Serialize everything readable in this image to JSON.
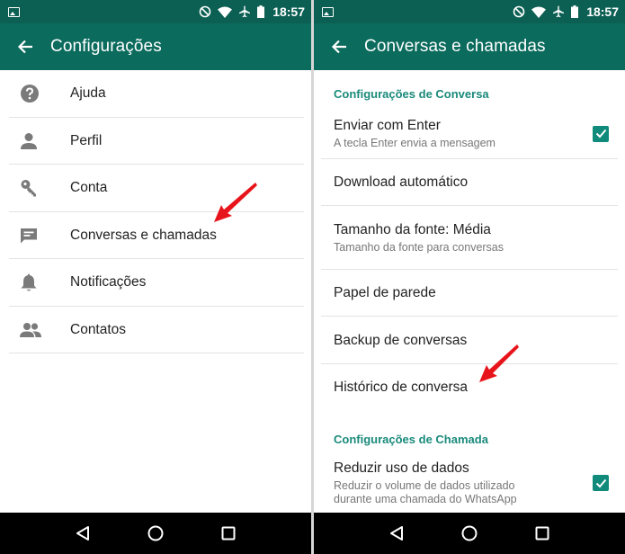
{
  "status_bar": {
    "time": "18:57"
  },
  "left_screen": {
    "title": "Configurações",
    "items": [
      {
        "label": "Ajuda",
        "icon": "help-icon"
      },
      {
        "label": "Perfil",
        "icon": "person-icon"
      },
      {
        "label": "Conta",
        "icon": "key-icon"
      },
      {
        "label": "Conversas e chamadas",
        "icon": "chat-icon"
      },
      {
        "label": "Notificações",
        "icon": "bell-icon"
      },
      {
        "label": "Contatos",
        "icon": "contacts-icon"
      }
    ]
  },
  "right_screen": {
    "title": "Conversas e chamadas",
    "section_chat": "Configurações de Conversa",
    "enter_send": {
      "title": "Enviar com Enter",
      "subtitle": "A tecla Enter envia a mensagem",
      "checked": true
    },
    "auto_download": {
      "title": "Download automático"
    },
    "font_size": {
      "title": "Tamanho da fonte: Média",
      "subtitle": "Tamanho da fonte para conversas"
    },
    "wallpaper": {
      "title": "Papel de parede"
    },
    "backup": {
      "title": "Backup de conversas"
    },
    "history": {
      "title": "Histórico de conversa"
    },
    "section_call": "Configurações de Chamada",
    "low_data": {
      "title": "Reduzir uso de dados",
      "subtitle_1": "Reduzir o volume de dados utilizado",
      "subtitle_2": "durante uma chamada do WhatsApp",
      "checked": true
    }
  },
  "colors": {
    "status_bar": "#0b5f53",
    "app_bar": "#0b6b5d",
    "accent": "#1a8a7b",
    "arrow": "#e8141b"
  }
}
